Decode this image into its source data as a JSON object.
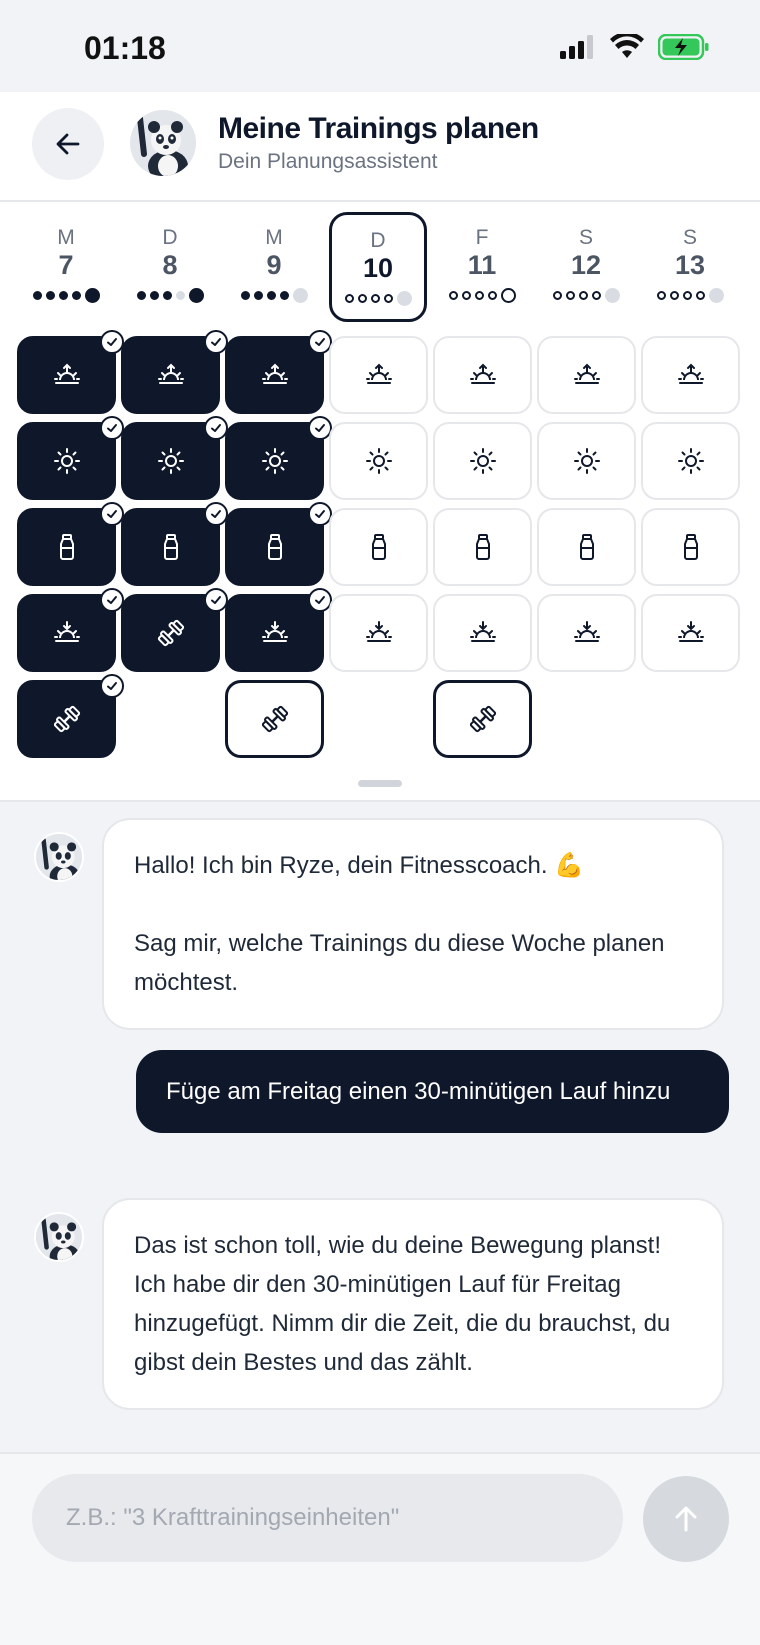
{
  "status_bar": {
    "time": "01:18",
    "battery_color": "#34c759"
  },
  "header": {
    "title": "Meine Trainings planen",
    "subtitle": "Dein Planungsassistent"
  },
  "calendar": {
    "days": [
      {
        "letter": "M",
        "number": "7",
        "selected": false,
        "dots": [
          "full",
          "full",
          "full",
          "full",
          "big-full"
        ]
      },
      {
        "letter": "D",
        "number": "8",
        "selected": false,
        "dots": [
          "full",
          "full",
          "full",
          "light",
          "big-full"
        ]
      },
      {
        "letter": "M",
        "number": "9",
        "selected": false,
        "dots": [
          "full",
          "full",
          "full",
          "full",
          "big-light"
        ]
      },
      {
        "letter": "D",
        "number": "10",
        "selected": true,
        "dots": [
          "ring",
          "ring",
          "ring",
          "ring",
          "big-light"
        ]
      },
      {
        "letter": "F",
        "number": "11",
        "selected": false,
        "dots": [
          "ring",
          "ring",
          "ring",
          "ring",
          "big-ring"
        ]
      },
      {
        "letter": "S",
        "number": "12",
        "selected": false,
        "dots": [
          "ring",
          "ring",
          "ring",
          "ring",
          "big-light"
        ]
      },
      {
        "letter": "S",
        "number": "13",
        "selected": false,
        "dots": [
          "ring",
          "ring",
          "ring",
          "ring",
          "big-light"
        ]
      }
    ],
    "rows": [
      {
        "icon": "sunrise-icon",
        "states": [
          "done",
          "done",
          "done",
          "open",
          "open",
          "open",
          "open"
        ]
      },
      {
        "icon": "sun-icon",
        "states": [
          "done",
          "done",
          "done",
          "open",
          "open",
          "open",
          "open"
        ]
      },
      {
        "icon": "bottle-icon",
        "states": [
          "done",
          "done",
          "done",
          "open",
          "open",
          "open",
          "open"
        ]
      },
      {
        "icon": "sunset-icon",
        "states": [
          "done",
          "workout-done",
          "done",
          "open",
          "open",
          "open",
          "open"
        ]
      },
      {
        "icon": "dumbbell-icon",
        "states": [
          "done",
          "empty",
          "outlined",
          "empty",
          "outlined",
          "empty",
          "empty"
        ]
      }
    ]
  },
  "chat": {
    "messages": [
      {
        "from": "bot",
        "text": "Hallo! Ich bin Ryze, dein Fitnesscoach. 💪\n\nSag mir, welche Trainings du diese Woche planen möchtest."
      },
      {
        "from": "user",
        "text": "Füge am Freitag einen 30-minütigen Lauf hinzu"
      },
      {
        "from": "bot",
        "text": "Das ist schon toll, wie du deine Bewegung planst! Ich habe dir den 30-minütigen Lauf für Freitag hinzugefügt. Nimm dir die Zeit, die du brauchst, du gibst dein Bestes und das zählt."
      }
    ]
  },
  "composer": {
    "placeholder": "Z.B.: \"3 Krafttrainingseinheiten\"",
    "value": ""
  },
  "colors": {
    "primary": "#0f172a",
    "chat_bg": "#f1f3f6",
    "muted": "#6b7280"
  }
}
